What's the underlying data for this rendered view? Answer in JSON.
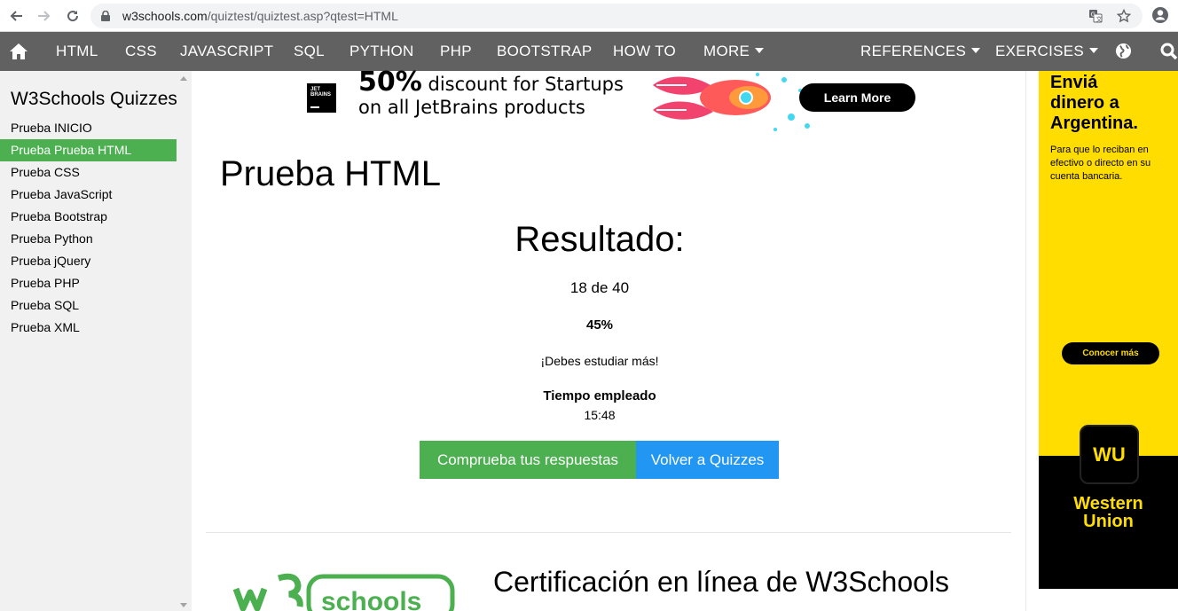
{
  "browser": {
    "url_host": "w3schools.com",
    "url_path": "/quiztest/quiztest.asp?qtest=HTML"
  },
  "topnav": {
    "home_icon": "home-icon",
    "items": [
      "HTML",
      "CSS",
      "JAVASCRIPT",
      "SQL",
      "PYTHON",
      "PHP",
      "BOOTSTRAP",
      "HOW TO",
      "MORE"
    ],
    "references": "REFERENCES",
    "exercises": "EXERCISES",
    "globe_icon": "globe-icon",
    "search_icon": "search-icon",
    "bg_color": "#616161"
  },
  "sidebar": {
    "title": "W3Schools Quizzes",
    "items": [
      "Prueba INICIO",
      "Prueba Prueba HTML",
      "Prueba CSS",
      "Prueba JavaScript",
      "Prueba Bootstrap",
      "Prueba Python",
      "Prueba jQuery",
      "Prueba PHP",
      "Prueba SQL",
      "Prueba XML"
    ],
    "active_index": 1,
    "active_color": "#4CAF50"
  },
  "ad_banner": {
    "logo_text": "JET BRAINS",
    "headline_big": "50%",
    "headline_rest": " discount for Startups",
    "headline_line2": "on all JetBrains products",
    "button": "Learn More"
  },
  "main": {
    "title": "Prueba HTML",
    "result_title": "Resultado:",
    "score": "18 de 40",
    "percent": "45%",
    "message": "¡Debes estudiar más!",
    "time_label": "Tiempo empleado",
    "time_value": "15:48",
    "check_button": "Comprueba tus respuestas",
    "back_button": "Volver a Quizzes",
    "cert_title": "Certificación en línea de W3Schools",
    "w3_logo_text": "schools"
  },
  "right_ad": {
    "headline": [
      "Enviá",
      "dinero a",
      "Argentina."
    ],
    "subtext": "Para que lo reciban en efectivo o directo en su cuenta bancaria.",
    "button": "Conocer más",
    "logo_text": "WU",
    "brand": [
      "Western",
      "Union"
    ],
    "yellow": "#FFDD00"
  }
}
